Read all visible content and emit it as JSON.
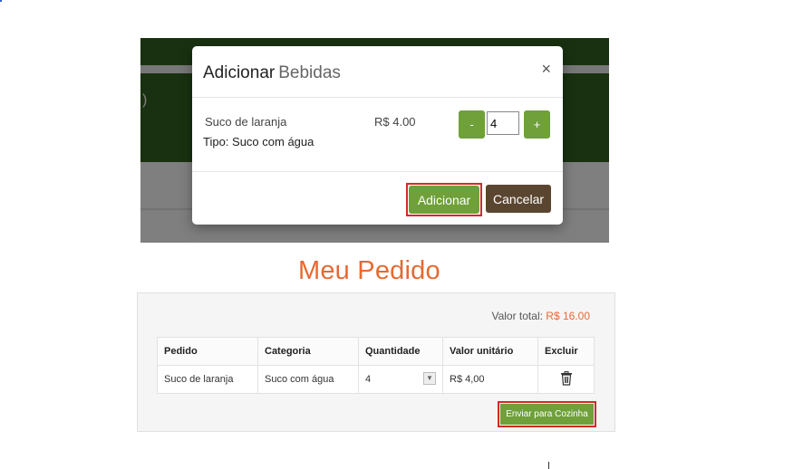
{
  "background": {
    "partial_text": ")"
  },
  "modal": {
    "title": "Adicionar",
    "title_sub": "Bebidas",
    "close_glyph": "×",
    "item": {
      "name": "Suco de laranja",
      "type": "Tipo: Suco com água",
      "price": "R$ 4.00"
    },
    "quantity": {
      "minus_label": "-",
      "plus_label": "+",
      "value": "4"
    },
    "add_label": "Adicionar",
    "cancel_label": "Cancelar"
  },
  "order": {
    "title": "Meu Pedido",
    "total_label": "Valor total:",
    "total_value": "R$ 16.00",
    "columns": [
      "Pedido",
      "Categoria",
      "Quantidade",
      "Valor unitário",
      "Excluir"
    ],
    "rows": [
      {
        "pedido": "Suco de laranja",
        "categoria": "Suco com água",
        "quantidade": "4",
        "valor": "R$ 4,00"
      }
    ],
    "send_label": "Enviar para Cozinha"
  },
  "colors": {
    "accent_green": "#6fa03a",
    "cancel_brown": "#5a4630",
    "title_orange": "#e56a32",
    "highlight_red": "#d32a2a",
    "header_green": "#2f5a1e"
  },
  "icons": [
    "close-icon",
    "trash-icon",
    "chevron-down-icon"
  ]
}
